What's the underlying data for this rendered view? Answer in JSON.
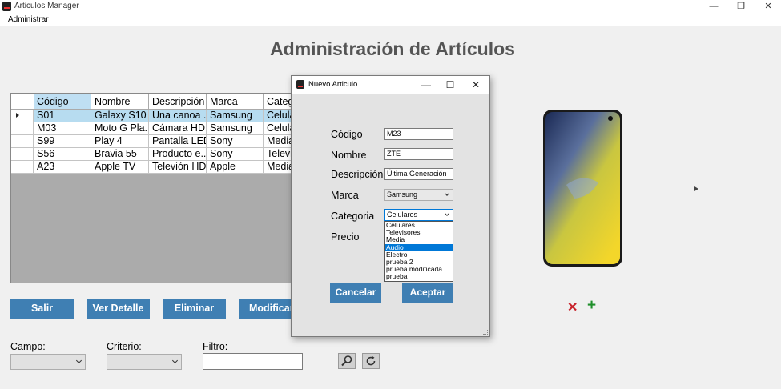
{
  "window": {
    "title": "Articulos Manager",
    "minimize": "—",
    "restore": "❐",
    "close": "✕"
  },
  "menu": {
    "items": [
      "Administrar"
    ]
  },
  "main": {
    "title": "Administración de Artículos"
  },
  "grid": {
    "columns": [
      "Código",
      "Nombre",
      "Descripción",
      "Marca",
      "Categ"
    ],
    "rows": [
      [
        "S01",
        "Galaxy S10",
        "Una canoa ...",
        "Samsung",
        "Celular"
      ],
      [
        "M03",
        "Moto G Pla...",
        "Cámara HD",
        "Samsung",
        "Celular"
      ],
      [
        "S99",
        "Play 4",
        "Pantalla LED",
        "Sony",
        "Media"
      ],
      [
        "S56",
        "Bravia 55",
        "Producto e...",
        "Sony",
        "Televis"
      ],
      [
        "A23",
        "Apple TV",
        "Televión HD",
        "Apple",
        "Media"
      ]
    ],
    "selected_row": 0
  },
  "buttons": {
    "salir": "Salir",
    "ver_detalle": "Ver Detalle",
    "eliminar": "Eliminar",
    "modificar": "Modificar"
  },
  "filters": {
    "campo_label": "Campo:",
    "criterio_label": "Criterio:",
    "filtro_label": "Filtro:",
    "campo_value": "",
    "criterio_value": "",
    "filtro_value": ""
  },
  "image_actions": {
    "delete": "✕",
    "add": "+"
  },
  "dialog": {
    "title": "Nuevo Articulo",
    "minimize": "—",
    "maximize": "☐",
    "close": "✕",
    "fields": {
      "codigo_label": "Código",
      "codigo_value": "M23",
      "nombre_label": "Nombre",
      "nombre_value": "ZTE",
      "descripcion_label": "Descripción",
      "descripcion_value": "Última Generación",
      "marca_label": "Marca",
      "marca_value": "Samsung",
      "categoria_label": "Categoria",
      "categoria_value": "Celulares",
      "precio_label": "Precio"
    },
    "categoria_options": [
      "Celulares",
      "Televisores",
      "Media",
      "Audio",
      "Electro",
      "prueba 2",
      "prueba modificada",
      "prueba"
    ],
    "highlighted_option": 3,
    "cancelar": "Cancelar",
    "aceptar": "Aceptar"
  },
  "colors": {
    "button_blue": "#3f7fb3",
    "selection_blue": "#b7dcf0",
    "accent_red": "#c8232c",
    "accent_green": "#1f8f2b"
  }
}
